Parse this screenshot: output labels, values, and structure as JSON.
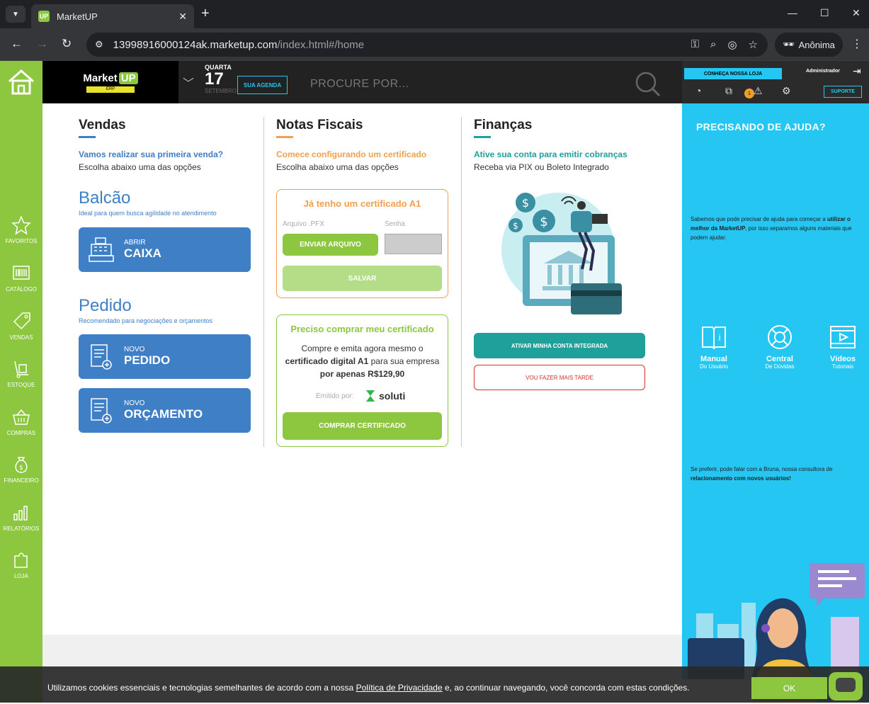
{
  "browser": {
    "tab_title": "MarketUP",
    "favicon_text": "UP",
    "url_host": "13998916000124ak.marketup.com",
    "url_path": "/index.html#/home",
    "profile_label": "Anônima"
  },
  "header": {
    "logo_text": "Market",
    "logo_up": "UP",
    "logo_sub": "ERP",
    "day_of_week": "QUARTA",
    "day": "17",
    "month": "SETEMBRO",
    "agenda_label": "SUA AGENDA",
    "search_placeholder": "PROCURE POR...",
    "conheca_label": "CONHEÇA NOSSA LOJA",
    "admin_label": "Administrador",
    "alert_count": "1",
    "support_label": "SUPORTE"
  },
  "sidebar": {
    "items": [
      {
        "label": "FAVORITOS"
      },
      {
        "label": "CATÁLOGO"
      },
      {
        "label": "VENDAS"
      },
      {
        "label": "ESTOQUE"
      },
      {
        "label": "COMPRAS"
      },
      {
        "label": "FINANCEIRO"
      },
      {
        "label": "RELATÓRIOS"
      },
      {
        "label": "LOJA"
      }
    ]
  },
  "vendas": {
    "title": "Vendas",
    "question": "Vamos realizar sua primeira venda?",
    "subtitle": "Escolha abaixo uma das opções",
    "balcao_title": "Balcão",
    "balcao_desc": "Ideal para quem busca agilidade no atendimento",
    "caixa_small": "ABRIR",
    "caixa_large": "CAIXA",
    "pedido_title": "Pedido",
    "pedido_desc": "Recomendado para negociações e orçamentos",
    "novo_pedido_small": "NOVO",
    "novo_pedido_large": "PEDIDO",
    "novo_orc_small": "NOVO",
    "novo_orc_large": "ORÇAMENTO"
  },
  "notas": {
    "title": "Notas Fiscais",
    "question": "Comece configurando um certificado",
    "subtitle": "Escolha abaixo uma das opções",
    "box1_title": "Já tenho um certificado A1",
    "arquivo_label": "Arquivo .PFX",
    "senha_label": "Senha",
    "enviar_label": "ENVIAR ARQUIVO",
    "salvar_label": "SALVAR",
    "box2_title": "Preciso comprar meu certificado",
    "box2_line1": "Compre e emita agora mesmo o",
    "box2_line2a": "certificado digital A1",
    "box2_line2b": " para sua empresa",
    "box2_line3": "por apenas R$129,90",
    "emitido_label": "Emitido por:",
    "soluti_label": "soluti",
    "comprar_label": "COMPRAR CERTIFICADO"
  },
  "financas": {
    "title": "Finanças",
    "question": "Ative sua conta para emitir cobranças",
    "subtitle": "Receba via PIX ou Boleto Integrado",
    "ativar_label": "ATIVAR MINHA CONTA INTEGRADA",
    "depois_label": "VOU FAZER MAIS TARDE"
  },
  "help": {
    "title": "PRECISANDO DE AJUDA?",
    "text1a": "Sabemos que pode precisar de ajuda para começar a ",
    "text1b": "utilizar o melhor da MarketUP",
    "text1c": ", por isso separamos alguns materiais que podem ajudar.",
    "links": [
      {
        "title": "Manual",
        "sub": "Do Usuário"
      },
      {
        "title": "Central",
        "sub": "De Dúvidas"
      },
      {
        "title": "Vídeos",
        "sub": "Tutoriais"
      }
    ],
    "text2a": "Se preferir, pode falar com a Bruna, nossa consultora de ",
    "text2b": "relacionamento com novos usuários!"
  },
  "cookie": {
    "text_before": "Utilizamos cookies essenciais e tecnologias semelhantes de acordo com a nossa ",
    "link": "Política de Privacidade",
    "text_after": " e, ao continuar navegando, você concorda com estas condições.",
    "ok_label": "OK"
  },
  "colors": {
    "brand_green": "#8dc63f",
    "blue": "#3f7fc6",
    "cyan": "#26c6f2",
    "orange": "#f0a050",
    "teal": "#20a09b",
    "red": "#d63030"
  }
}
